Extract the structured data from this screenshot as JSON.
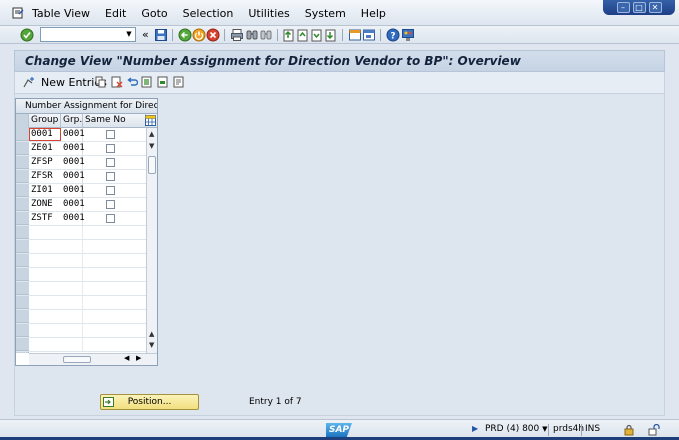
{
  "menubar": {
    "items": [
      {
        "label": "Table View"
      },
      {
        "label": "Edit"
      },
      {
        "label": "Goto"
      },
      {
        "label": "Selection"
      },
      {
        "label": "Utilities"
      },
      {
        "label": "System"
      },
      {
        "label": "Help"
      }
    ]
  },
  "title": "Change View \"Number Assignment for Direction  Vendor to BP\": Overview",
  "toolbar": {
    "new_entries_label": "New Entries",
    "command_value": ""
  },
  "table": {
    "caption": "Number Assignment for Directio...",
    "headers": [
      "Group",
      "Grp.",
      "Same No"
    ],
    "rows": [
      {
        "group": "0001",
        "grp": "0001",
        "same": false
      },
      {
        "group": "ZE01",
        "grp": "0001",
        "same": false
      },
      {
        "group": "ZFSP",
        "grp": "0001",
        "same": false
      },
      {
        "group": "ZFSR",
        "grp": "0001",
        "same": false
      },
      {
        "group": "ZI01",
        "grp": "0001",
        "same": false
      },
      {
        "group": "ZONE",
        "grp": "0001",
        "same": false
      },
      {
        "group": "ZSTF",
        "grp": "0001",
        "same": false
      }
    ]
  },
  "position_button_label": "Position...",
  "entry_text": "Entry 1 of 7",
  "status": {
    "logo": "SAP",
    "system": "PRD (4) 800",
    "server": "prds4h",
    "mode": "INS"
  },
  "colors": {
    "accent_blue": "#1e3f86",
    "button_yellow": "#f1df7e",
    "header_bg": "#c5d3e4"
  },
  "icons": {
    "enter": "check-circle-icon",
    "save": "floppy-disk-icon",
    "back": "back-arrow-icon",
    "exit": "exit-icon",
    "cancel": "cancel-icon",
    "print": "printer-icon",
    "find": "binoculars-icon",
    "help": "help-icon"
  }
}
